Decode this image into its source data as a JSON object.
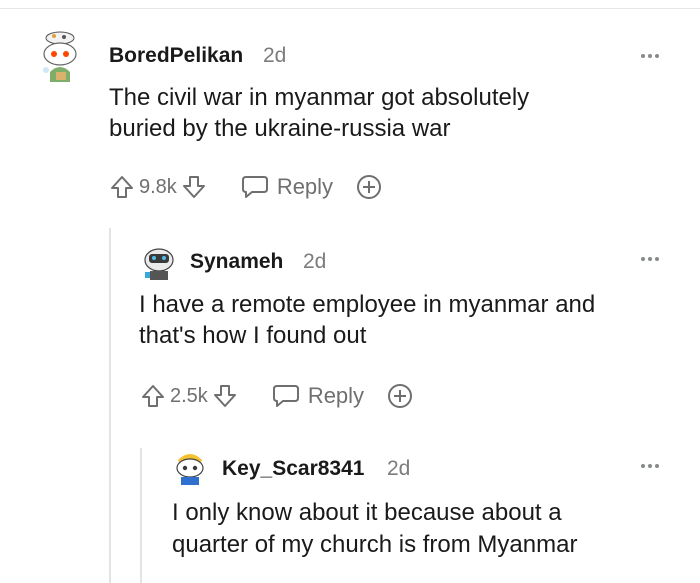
{
  "comments": [
    {
      "username": "BoredPelikan",
      "age": "2d",
      "body_line1": "The civil war in myanmar got absolutely",
      "body_line2": "buried by the ukraine-russia war",
      "votes": "9.8k",
      "reply_label": "Reply",
      "avatar_icon": "snoo-avatar-icon"
    },
    {
      "username": "Synameh",
      "age": "2d",
      "body_line1": "I have a remote employee in myanmar and",
      "body_line2": "that's how I found out",
      "votes": "2.5k",
      "reply_label": "Reply",
      "avatar_icon": "snoo-avatar-icon"
    },
    {
      "username": "Key_Scar8341",
      "age": "2d",
      "body_line1": "I only know about it because about a",
      "body_line2": "quarter of my church is from Myanmar",
      "avatar_icon": "snoo-avatar-icon"
    }
  ],
  "colors": {
    "text": "#1a1a1b",
    "meta": "#7c7c7c",
    "thread_line": "#e4e4e4"
  }
}
